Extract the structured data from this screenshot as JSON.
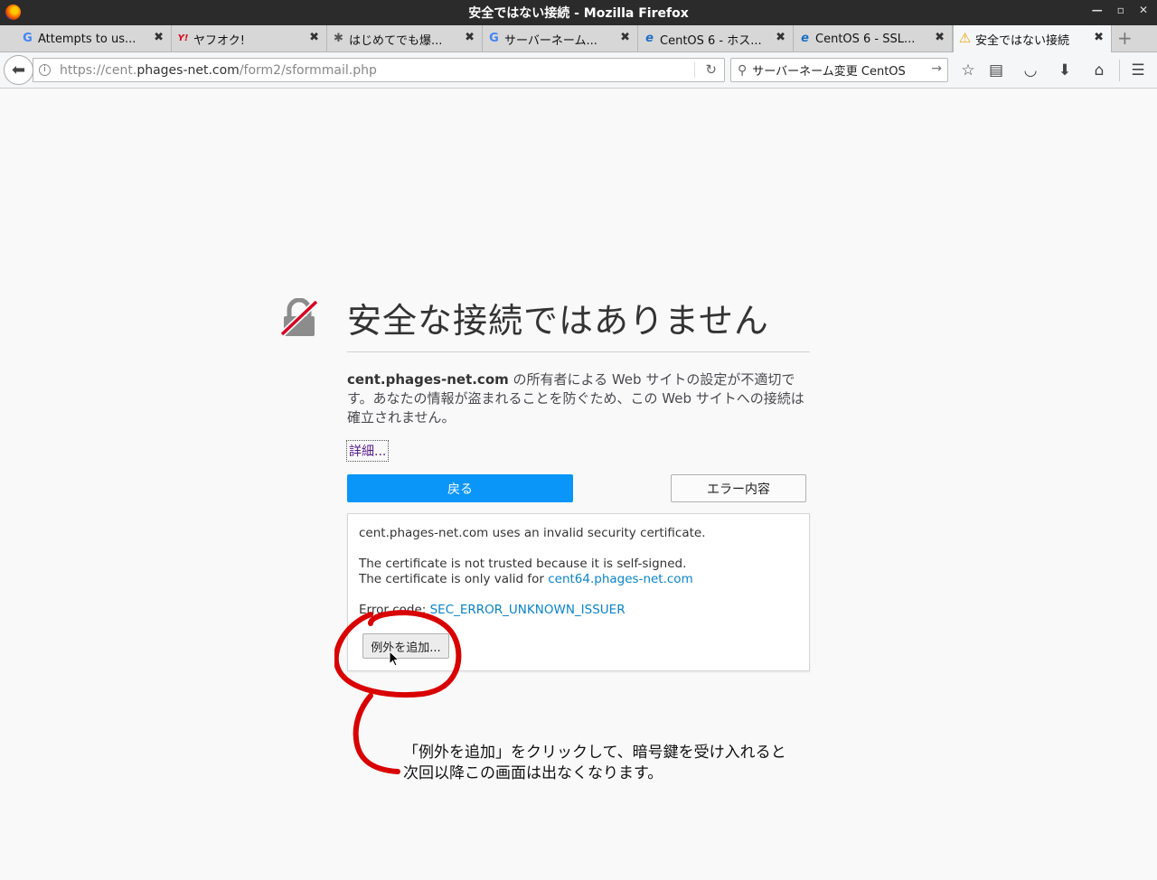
{
  "window": {
    "title": "安全ではない接続 - Mozilla Firefox"
  },
  "tabs": [
    {
      "label": "Attempts to us...",
      "favicon": "google-icon",
      "favicon_glyph": "G",
      "color": "#4285f4"
    },
    {
      "label": "ヤフオク!",
      "favicon": "yahoo-icon",
      "favicon_glyph": "Y!",
      "color": "#d40f1f"
    },
    {
      "label": "はじめてでも爆...",
      "favicon": "puzzle-icon",
      "favicon_glyph": "✱",
      "color": "#555555"
    },
    {
      "label": "サーバーネーム...",
      "favicon": "google-icon",
      "favicon_glyph": "G",
      "color": "#4285f4"
    },
    {
      "label": "CentOS 6 - ホス...",
      "favicon": "ie-icon",
      "favicon_glyph": "e",
      "color": "#1f6fc5"
    },
    {
      "label": "CentOS 6 - SSL...",
      "favicon": "ie-icon",
      "favicon_glyph": "e",
      "color": "#1f6fc5"
    },
    {
      "label": "安全ではない接続",
      "favicon": "warning-icon",
      "favicon_glyph": "⚠",
      "color": "#e8a400"
    }
  ],
  "navbar": {
    "url_prefix": "https://cent.",
    "url_domain": "phages-net.com",
    "url_path": "/form2/sformmail.php",
    "search_text": "サーバーネーム変更 CentOS"
  },
  "error": {
    "title": "安全な接続ではありません",
    "host": "cent.phages-net.com",
    "description": " の所有者による Web サイトの設定が不適切です。あなたの情報が盗まれることを防ぐため、この Web サイトへの接続は確立されません。",
    "advanced_label": "詳細...",
    "back_label": "戻る",
    "details_label": "エラー内容"
  },
  "advanced": {
    "line1": "cent.phages-net.com uses an invalid security certificate.",
    "line2": "The certificate is not trusted because it is self-signed.",
    "line3_prefix": "The certificate is only valid for ",
    "line3_link": "cent64.phages-net.com",
    "error_code_prefix": "Error code: ",
    "error_code": "SEC_ERROR_UNKNOWN_ISSUER",
    "add_exception_label": "例外を追加..."
  },
  "annotation": {
    "line1": "「例外を追加」をクリックして、暗号鍵を受け入れると",
    "line2": "次回以降この画面は出なくなります。",
    "color": "#d90000"
  }
}
